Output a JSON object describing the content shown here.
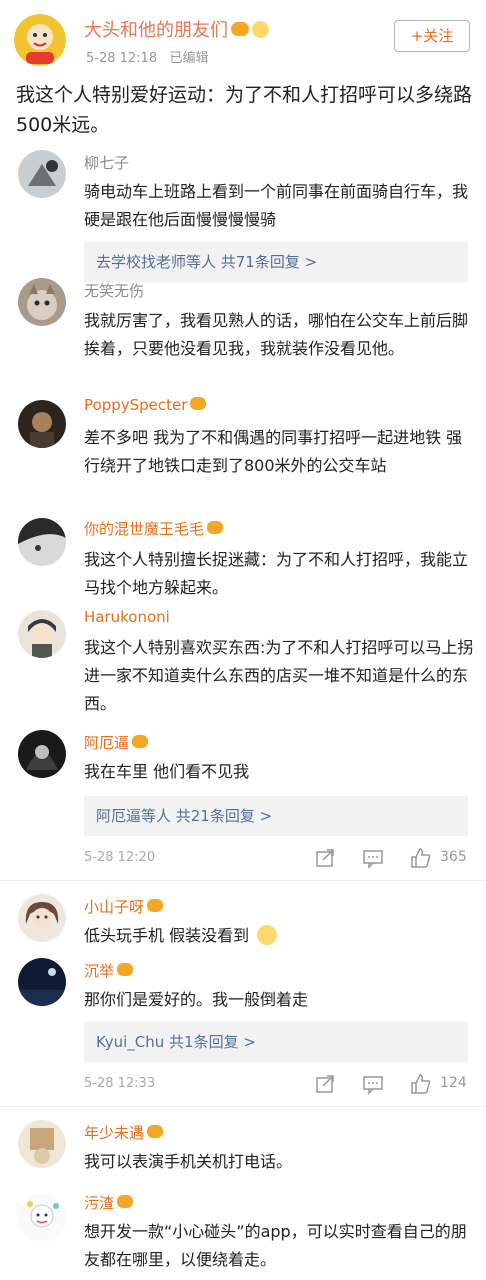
{
  "post": {
    "author": "大头和他的朋友们",
    "date": "5-28 12:18",
    "edited": "已编辑",
    "follow_label": "+关注",
    "text": "我这个人特别爱好运动：为了不和人打招呼可以多绕路500米远。"
  },
  "threads": [
    {
      "comments": [
        {
          "name": "柳七子",
          "text": "骑电动车上班路上看到一个前同事在前面骑自行车，我硬是跟在他后面慢慢慢慢骑"
        }
      ],
      "reply_summary": "去学校找老师等人  共71条回复 >"
    },
    {
      "comments": [
        {
          "name": "无笑无伤",
          "text": "我就厉害了，我看见熟人的话，哪怕在公交车上前后脚挨着，只要他没看见我，我就装作没看见他。"
        },
        {
          "name": "PoppySpecter",
          "text": "差不多吧 我为了不和偶遇的同事打招呼一起进地铁 强行绕开了地铁口走到了800米外的公交车站"
        },
        {
          "name": "你的混世魔王毛毛",
          "text": "我这个人特别擅长捉迷藏：为了不和人打招呼，我能立马找个地方躲起来。"
        },
        {
          "name": "Harukononi",
          "text": "我这个人特别喜欢买东西:为了不和人打招呼可以马上拐进一家不知道卖什么东西的店买一堆不知道是什么的东西。"
        },
        {
          "name": "阿厄逼",
          "text": "我在车里 他们看不见我"
        }
      ],
      "reply_summary": "阿厄逼等人  共21条回复 >",
      "time": "5-28 12:20",
      "likes": "365"
    },
    {
      "comments": [
        {
          "name": "小山子呀",
          "text": "低头玩手机 假装没看到"
        },
        {
          "name": "沉举",
          "text": "那你们是爱好的。我一般倒着走"
        }
      ],
      "reply_summary": "Kyui_Chu  共1条回复 >",
      "time": "5-28 12:33",
      "likes": "124"
    },
    {
      "comments": [
        {
          "name": "年少未遇",
          "text": "我可以表演手机关机打电话。"
        },
        {
          "name": "污渣",
          "text": "想开发一款“小心碰头”的app，可以实时查看自己的朋友都在哪里，以便绕着走。"
        }
      ]
    }
  ],
  "colors": {
    "accent_orange": "#e86e1a",
    "name_orange": "#eb7350",
    "link_blue": "#566f99",
    "reply_bg": "#f2f2f2"
  },
  "icons": [
    "share-icon",
    "comment-icon",
    "like-icon",
    "vip-badge-icon",
    "emoji-icon"
  ]
}
